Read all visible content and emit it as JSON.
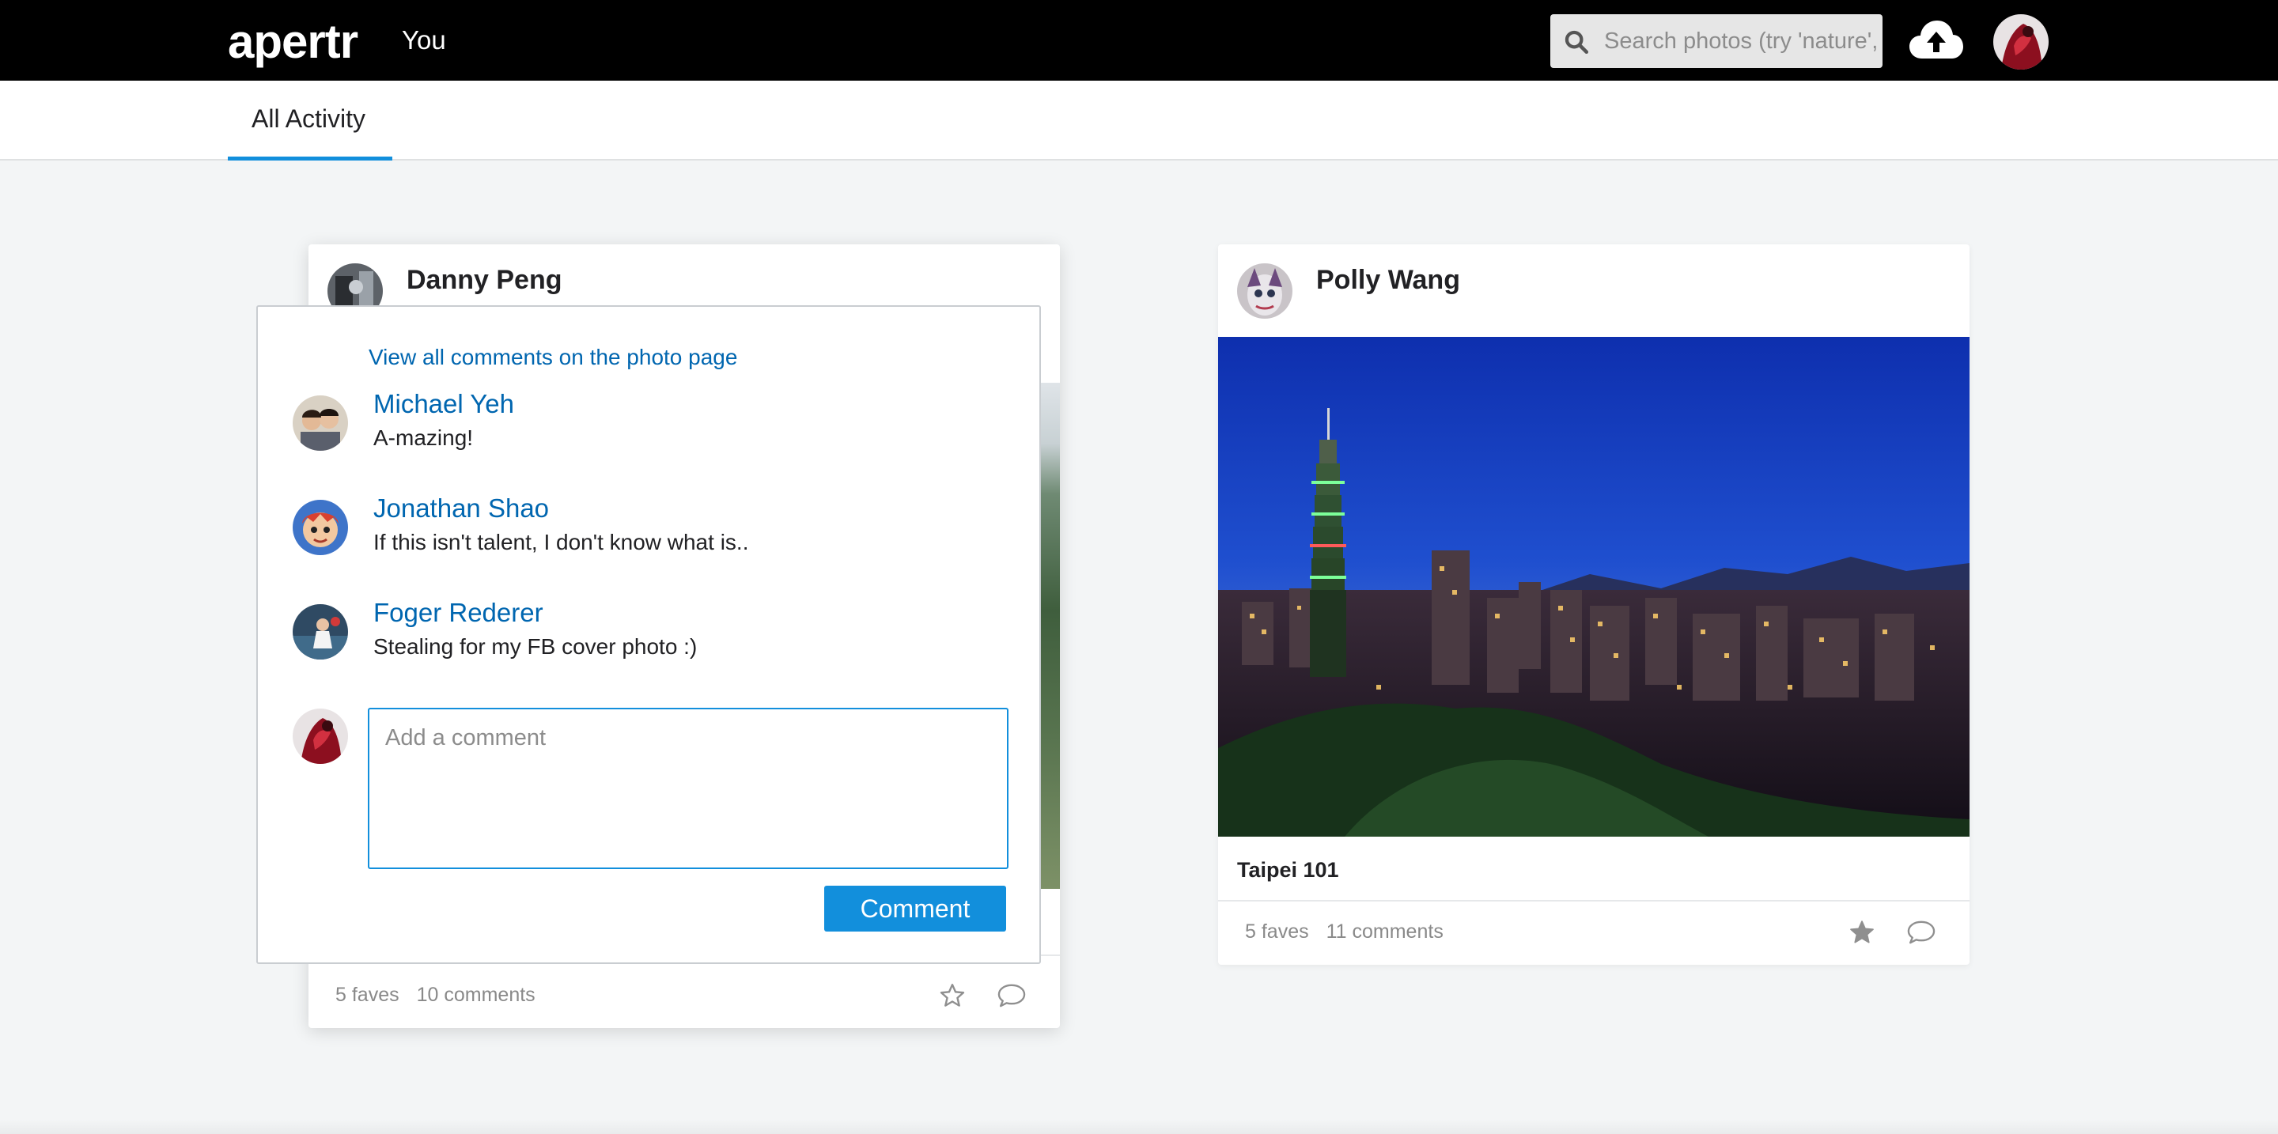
{
  "app": {
    "logo": "apertr",
    "nav_you": "You"
  },
  "search": {
    "placeholder": "Search photos (try 'nature', 'animals', etc.)"
  },
  "icons": {
    "search": "search-icon",
    "upload": "cloud-upload-icon",
    "fave": "star-icon",
    "comment": "speech-bubble-icon"
  },
  "subnav": {
    "tab_all": "All Activity"
  },
  "colors": {
    "accent": "#128fdc",
    "link": "#0066b0",
    "topbar": "#000000",
    "background": "#f3f5f6"
  },
  "feed": {
    "left_card": {
      "author": "Danny Peng",
      "faves": "5 faves",
      "comments_count": "10 comments",
      "popup": {
        "view_all": "View all comments on the photo page",
        "comments": [
          {
            "name": "Michael Yeh",
            "text": "A-mazing!"
          },
          {
            "name": "Jonathan Shao",
            "text": "If this isn't talent, I don't know what is.."
          },
          {
            "name": "Foger Rederer",
            "text": "Stealing for my FB cover photo :)"
          }
        ],
        "input_placeholder": "Add a comment",
        "submit_label": "Comment"
      }
    },
    "right_card": {
      "author": "Polly Wang",
      "caption": "Taipei 101",
      "faves": "5 faves",
      "comments_count": "11 comments"
    }
  }
}
